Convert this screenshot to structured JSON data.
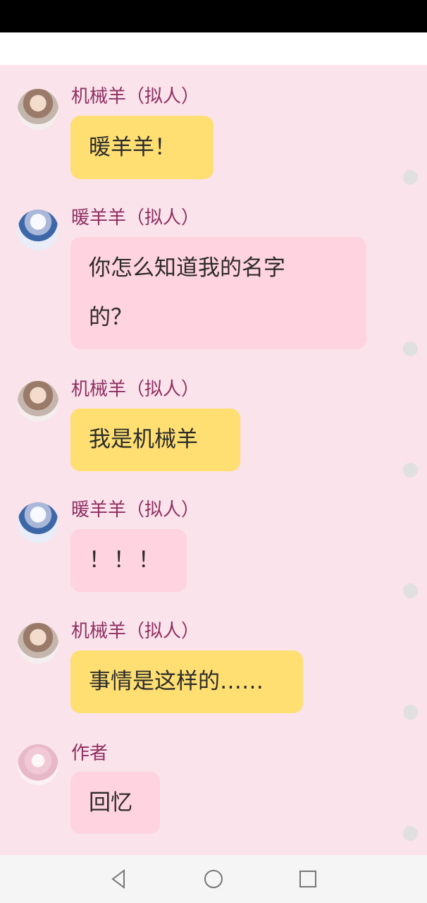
{
  "messages": [
    {
      "sender": "机械羊（拟人）",
      "text": "暖羊羊！",
      "avatar_icon": "mech-sheep-avatar"
    },
    {
      "sender": "暖羊羊（拟人）",
      "text_lines": [
        "你怎么知道我的名字",
        "的？"
      ],
      "avatar_icon": "warm-sheep-avatar"
    },
    {
      "sender": "机械羊（拟人）",
      "text": "我是机械羊",
      "avatar_icon": "mech-sheep-avatar"
    },
    {
      "sender": "暖羊羊（拟人）",
      "text": "！！！",
      "avatar_icon": "warm-sheep-avatar"
    },
    {
      "sender": "机械羊（拟人）",
      "text": "事情是这样的……",
      "avatar_icon": "mech-sheep-avatar"
    },
    {
      "sender": "作者",
      "text": "回忆",
      "avatar_icon": "author-avatar"
    }
  ],
  "colors": {
    "background": "#fae3ea",
    "bubble_yellow": "#ffdf72",
    "bubble_pink": "#ffd3df",
    "name_color": "#8f2f62"
  },
  "nav": {
    "back_icon": "back-triangle-icon",
    "home_icon": "home-circle-icon",
    "recent_icon": "recent-square-icon"
  }
}
